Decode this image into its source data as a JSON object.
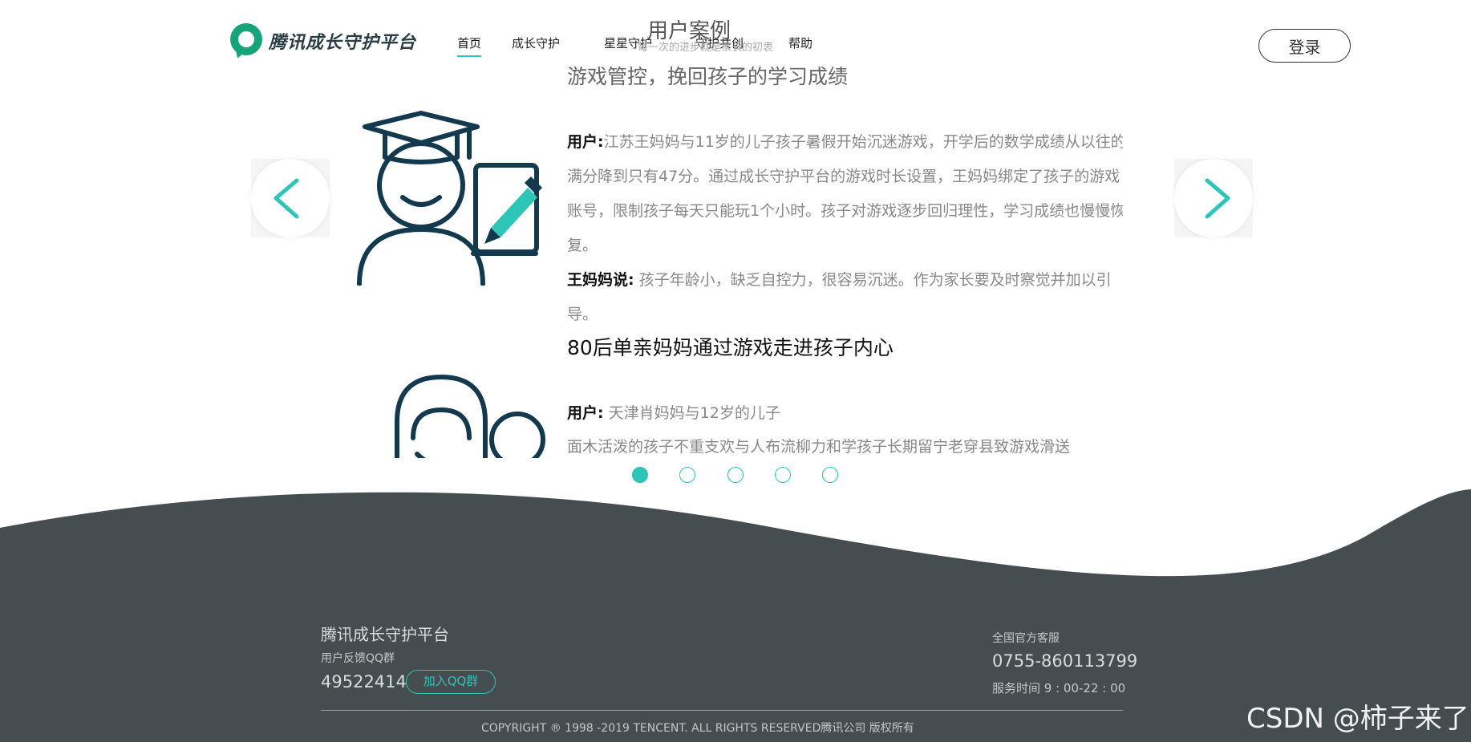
{
  "brand": {
    "name": "腾讯成长守护平台",
    "logo_icon": "speech-ring-logo-icon",
    "logo_color": "#14a37a"
  },
  "nav": {
    "items": [
      {
        "label": "首页",
        "active": true
      },
      {
        "label": "成长守护"
      },
      {
        "label": "星星守护"
      },
      {
        "label": "守护共创"
      },
      {
        "label": "帮助"
      }
    ]
  },
  "section": {
    "title": "用户案例",
    "subtitle": "每一次的进步就是家长的初衷"
  },
  "header": {
    "login_label": "登录"
  },
  "carousel": {
    "prev_icon": "chevron-left-icon",
    "next_icon": "chevron-right-icon",
    "accent": "#2cc5b8",
    "slides": [
      {
        "title": "游戏管控，挽回孩子的学习成绩",
        "icon": "graduate-student-icon",
        "user_label": "用户:",
        "user_text": "江苏王妈妈与11岁的儿子孩子暑假开始沉迷游戏，开学后的数学成绩从以往的满分降到只有47分。通过成长守护平台的游戏时长设置，王妈妈绑定了孩子的游戏账号，限制孩子每天只能玩1个小时。孩子对游戏逐步回归理性，学习成绩也慢慢恢复。",
        "quote_label": "王妈妈说:",
        "quote_text": "孩子年龄小，缺乏自控力，很容易沉迷。作为家长要及时察觉并加以引导。"
      },
      {
        "title": "80后单亲妈妈通过游戏走进孩子内心",
        "icon": "mother-child-icon",
        "user_label": "用户:",
        "user_text": "天津肖妈妈与12岁的儿子",
        "extra_text": "面木活泼的孩子不重支欢与人布流柳力和学孩子长期留宁老穿县致游戏滑送"
      }
    ],
    "dots": [
      {
        "active": true
      },
      {
        "active": false
      },
      {
        "active": false
      },
      {
        "active": false
      },
      {
        "active": false
      }
    ]
  },
  "footer": {
    "background": "#464d50",
    "title": "腾讯成长守护平台",
    "qq_group_label": "用户反馈QQ群",
    "qq_number": "49522414",
    "join_qq_label": "加入QQ群",
    "service_label": "全国官方客服",
    "service_phone": "0755-860113799",
    "service_hours": "服务时间 9 : 00-22 : 00",
    "copyright": "COPYRIGHT ® 1998 -2019 TENCENT. ALL RIGHTS RESERVED腾讯公司 版权所有"
  },
  "watermark": "CSDN @柿子来了"
}
